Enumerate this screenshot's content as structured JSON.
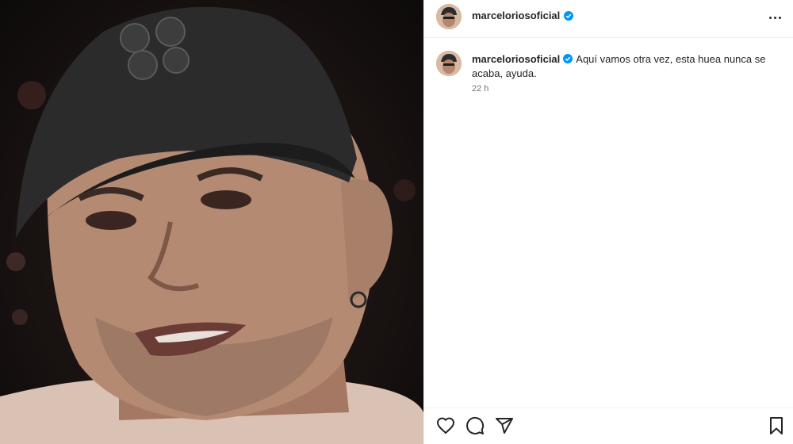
{
  "post": {
    "username": "marceloriosoficial",
    "caption": "Aquí vamos otra vez, esta huea nunca se acaba, ayuda.",
    "timestamp": "22 h"
  },
  "icons": {
    "more": "more-options-icon",
    "verified": "verified-badge-icon",
    "like": "heart-icon",
    "comment": "comment-icon",
    "share": "share-icon",
    "save": "bookmark-icon"
  },
  "colors": {
    "verified": "#0095f6",
    "text": "#262626",
    "muted": "#737373",
    "border": "#efefef"
  }
}
